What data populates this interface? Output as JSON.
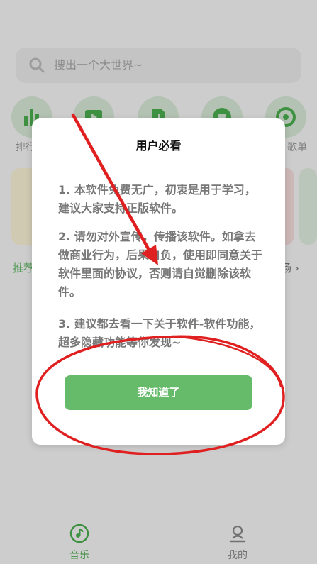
{
  "search": {
    "placeholder": "搜出一个大世界~"
  },
  "categories": [
    {
      "label": "排行",
      "icon": "bar-chart-icon"
    },
    {
      "label": "",
      "icon": "video-play-icon"
    },
    {
      "label": "",
      "icon": "music-file-icon"
    },
    {
      "label": "",
      "icon": "heart-icon"
    },
    {
      "label": "歌单",
      "icon": "disc-icon"
    }
  ],
  "behind": {
    "left_label": "推荐",
    "right_label": "场"
  },
  "dialog": {
    "title": "用户必看",
    "paragraphs": [
      "1. 本软件免费无广，初衷是用于学习，建议大家支持正版软件。",
      "2. 请勿对外宣传，传播该软件。如拿去做商业行为，后果自负，使用即同意关于软件里面的协议，否则请自觉删除该软件。",
      "3. 建议都去看一下关于软件-软件功能，超多隐藏功能等你发现~"
    ],
    "confirm_button": "我知道了"
  },
  "bottom_nav": [
    {
      "label": "音乐",
      "icon": "music-note-icon",
      "active": true
    },
    {
      "label": "我的",
      "icon": "user-icon",
      "active": false
    }
  ],
  "colors": {
    "accent": "#66bb6a",
    "annotation": "#e02020"
  }
}
